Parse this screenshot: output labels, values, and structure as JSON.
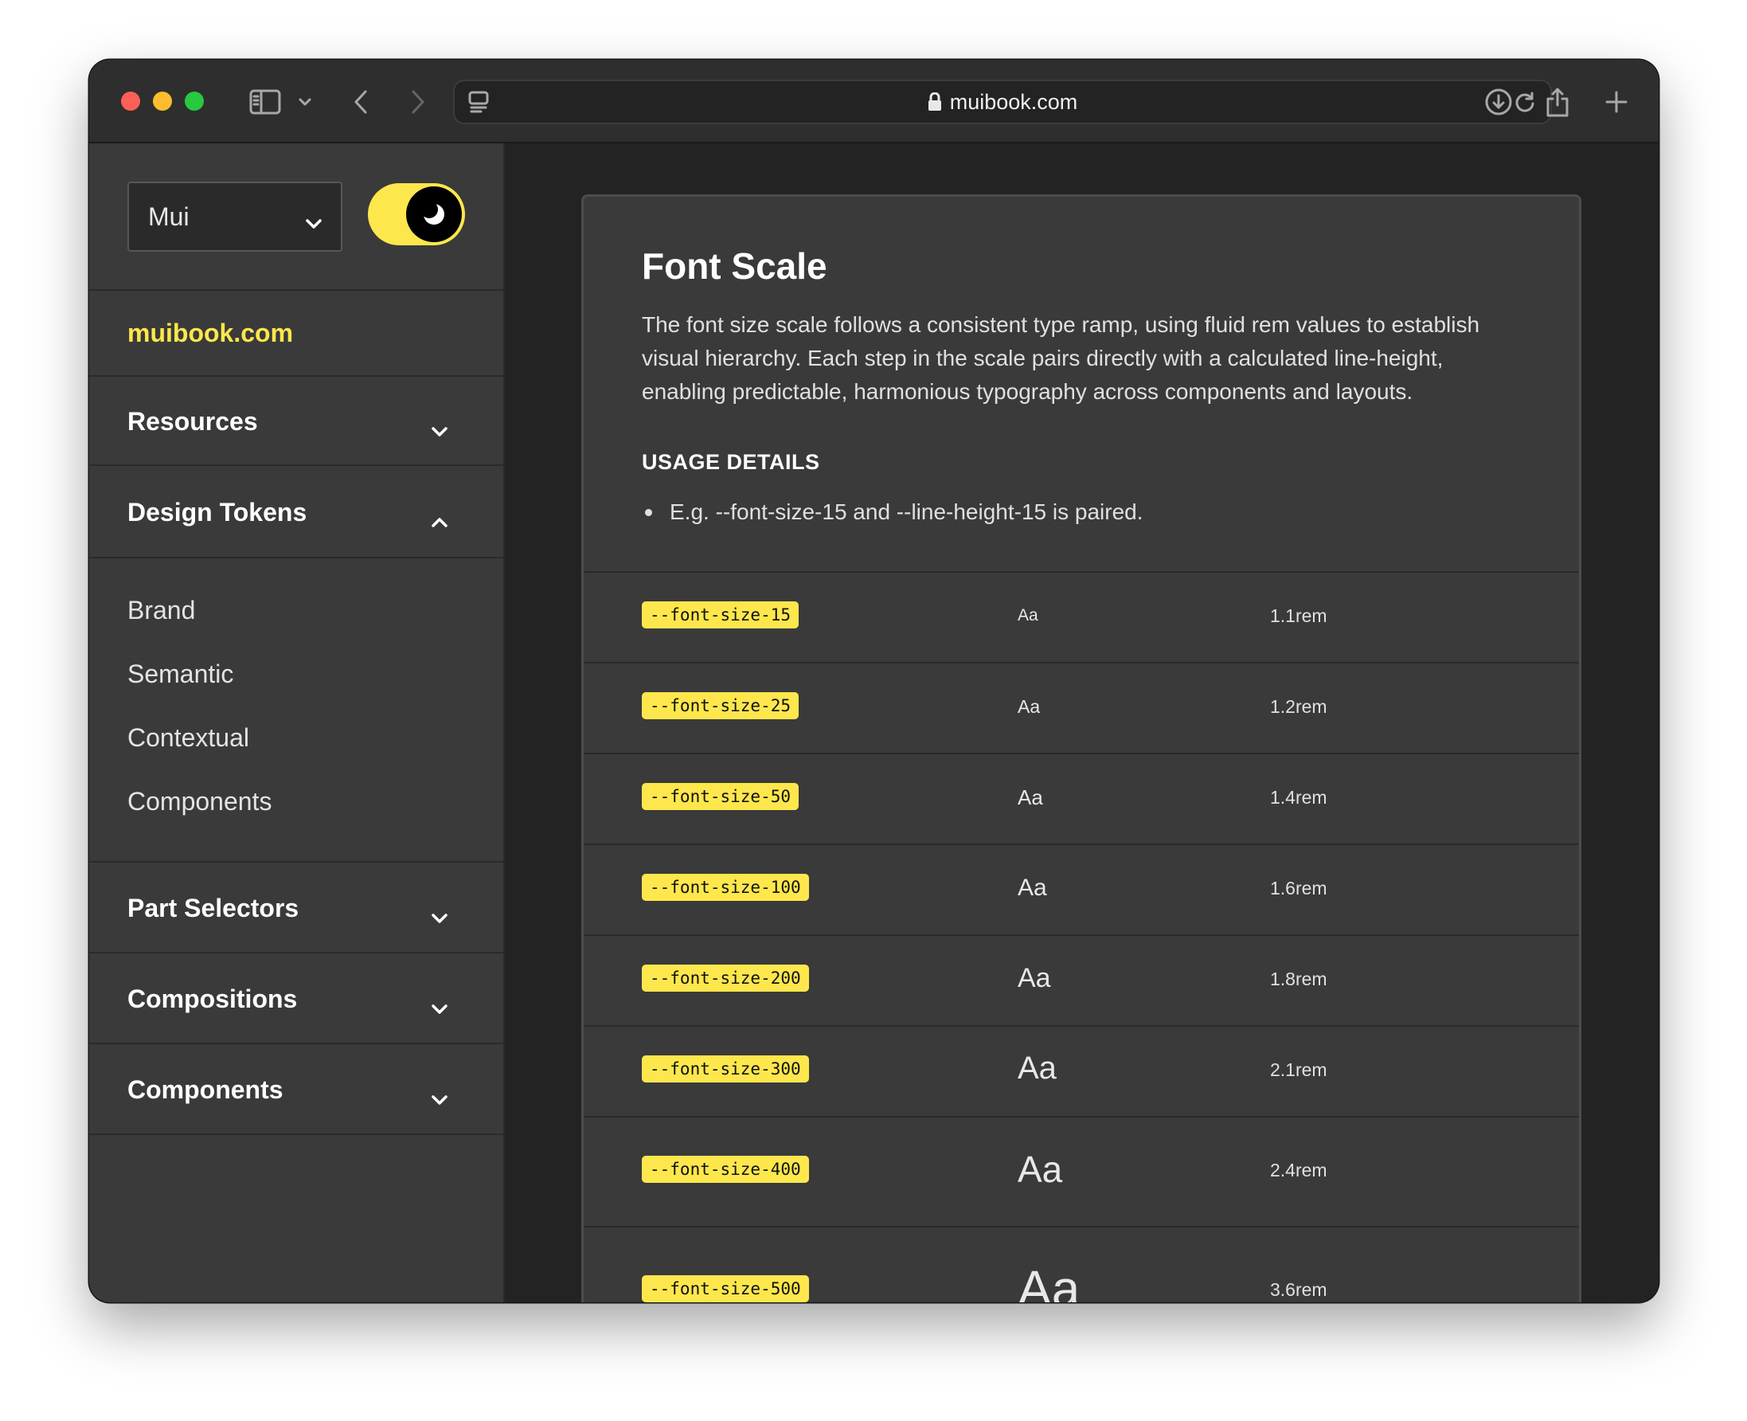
{
  "browser": {
    "url": "muibook.com"
  },
  "sidebar": {
    "theme_select": "Mui",
    "brand_link": "muibook.com",
    "sections": [
      {
        "label": "Resources",
        "expanded": false
      },
      {
        "label": "Design Tokens",
        "expanded": true
      },
      {
        "label": "Part Selectors",
        "expanded": false
      },
      {
        "label": "Compositions",
        "expanded": false
      },
      {
        "label": "Components",
        "expanded": false
      }
    ],
    "design_tokens_items": [
      "Brand",
      "Semantic",
      "Contextual",
      "Components"
    ]
  },
  "main": {
    "title": "Font Scale",
    "description": "The font size scale follows a consistent type ramp, using fluid rem values to establish visual hierarchy. Each step in the scale pairs directly with a calculated line-height, enabling predictable, harmonious typography across components and layouts.",
    "usage_heading": "USAGE DETAILS",
    "usage_bullet": "E.g. --font-size-15 and --line-height-15 is paired.",
    "sample_text": "Aa",
    "tokens": [
      {
        "name": "--font-size-15",
        "value": "1.1rem"
      },
      {
        "name": "--font-size-25",
        "value": "1.2rem"
      },
      {
        "name": "--font-size-50",
        "value": "1.4rem"
      },
      {
        "name": "--font-size-100",
        "value": "1.6rem"
      },
      {
        "name": "--font-size-200",
        "value": "1.8rem"
      },
      {
        "name": "--font-size-300",
        "value": "2.1rem"
      },
      {
        "name": "--font-size-400",
        "value": "2.4rem"
      },
      {
        "name": "--font-size-500",
        "value": "3.6rem"
      }
    ]
  },
  "colors": {
    "accent": "#fde74c",
    "background": "#232323",
    "panel": "#3a3a3a"
  }
}
